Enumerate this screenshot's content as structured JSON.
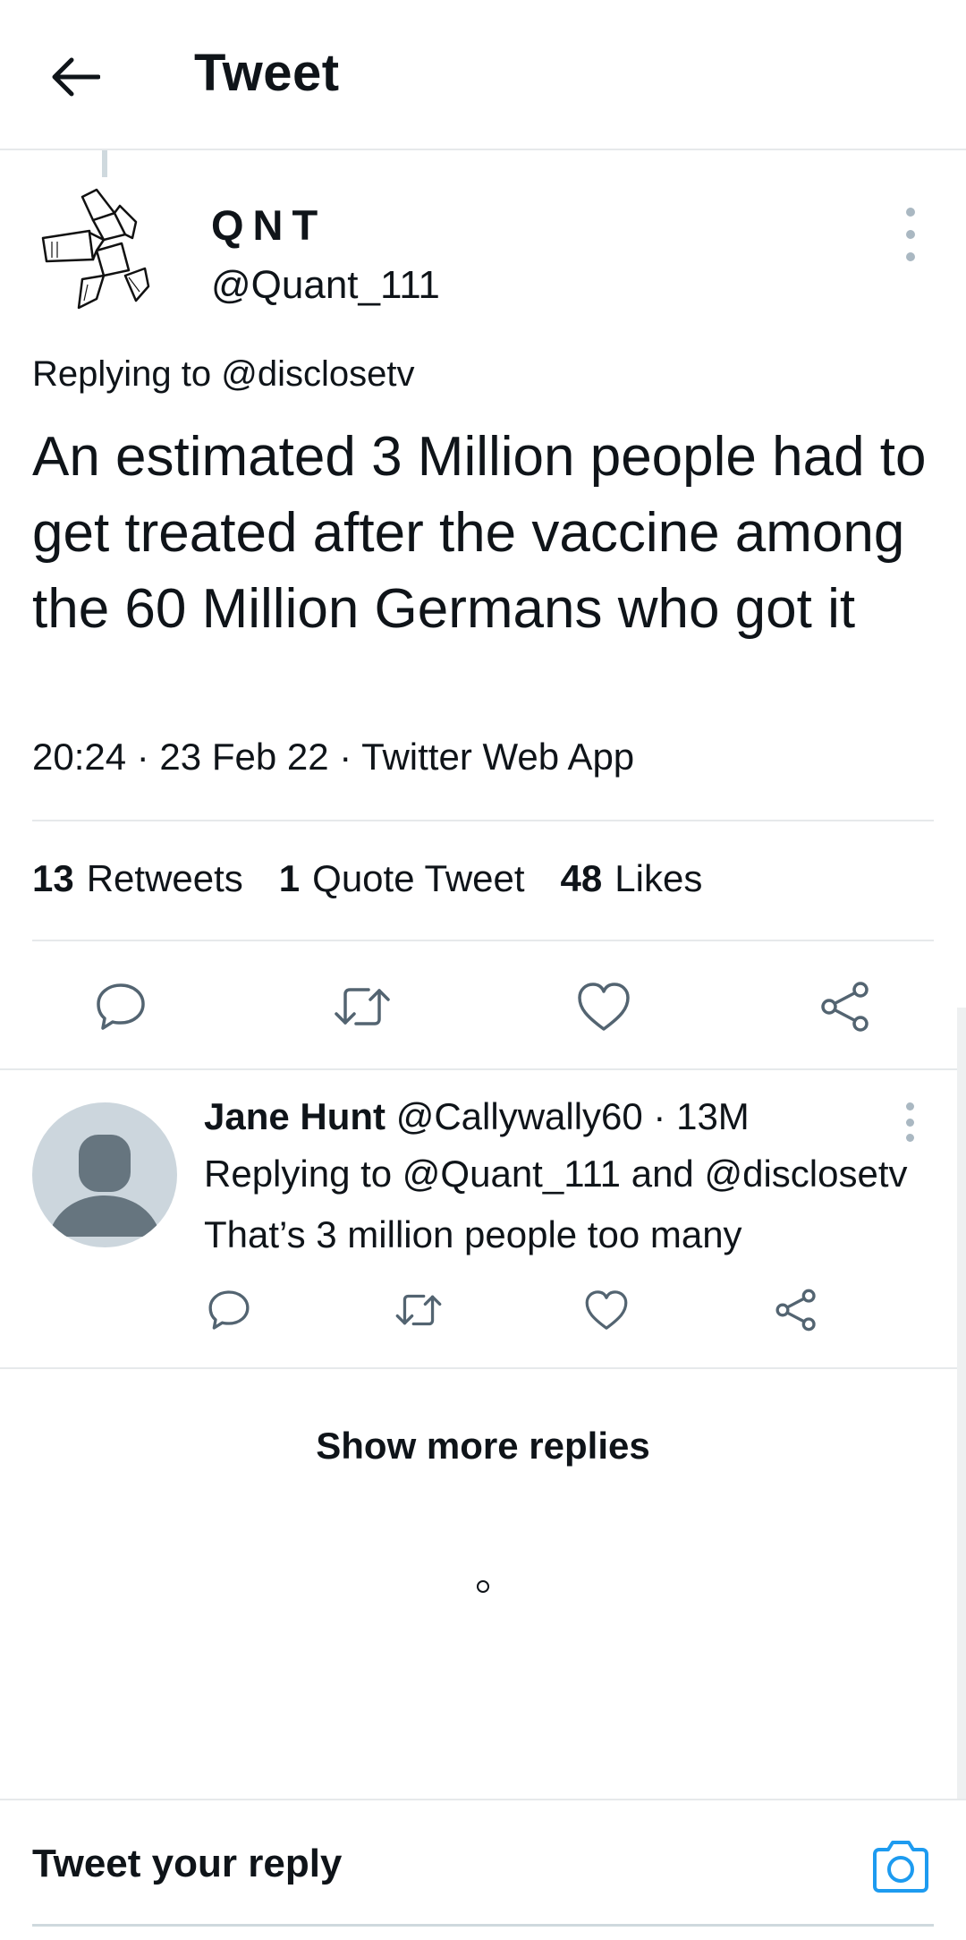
{
  "header": {
    "title": "Tweet"
  },
  "main_tweet": {
    "display_name": "QNT",
    "handle": "@Quant_111",
    "replying_to": "Replying to @disclosetv",
    "text": "An estimated 3 Million people had to get treated after the vaccine among the 60 Million Germans who got it",
    "meta": "20:24 · 23 Feb 22 · Twitter Web App",
    "stats": {
      "retweets_count": "13",
      "retweets_label": "Retweets",
      "quotes_count": "1",
      "quotes_label": "Quote Tweet",
      "likes_count": "48",
      "likes_label": "Likes"
    }
  },
  "reply": {
    "display_name": "Jane Hunt",
    "handle_time": "@Callywally60 · 13M",
    "replying_to": "Replying to @Quant_111 and @disclosetv",
    "text": "That’s 3 million people too many"
  },
  "show_more": "Show more replies",
  "composer": {
    "placeholder": "Tweet your reply"
  },
  "colors": {
    "accent": "#1d9bf0",
    "divider": "#e6e9eb",
    "avatar_bg": "#ccd6dd",
    "avatar_fg": "#66757f"
  }
}
